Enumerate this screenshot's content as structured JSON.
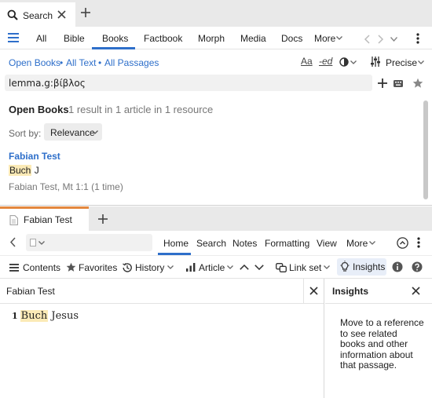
{
  "top_panel": {
    "tab": {
      "label": "Search"
    },
    "search_types": [
      "All",
      "Bible",
      "Books",
      "Factbook",
      "Morph",
      "Media",
      "Docs"
    ],
    "active_type": "Books",
    "more_label": "More",
    "scope": {
      "open_books": "Open Books",
      "all_text": "All Text",
      "all_passages": "All Passages",
      "separator": "•"
    },
    "options": {
      "aa": "Aa",
      "ed": "-ed",
      "match_mode": "Precise"
    },
    "query": "lemma.g:βίβλος",
    "results": {
      "title": "Open Books",
      "summary": "1 result in 1 article in 1 resource",
      "sort_label": "Sort by:",
      "sort_value": "Relevance",
      "item": {
        "title": "Fabian Test",
        "hit_word": "Buch",
        "rest": " J",
        "meta": "Fabian Test, Mt 1:1 (1 time)"
      }
    }
  },
  "bottom_panel": {
    "tab": {
      "label": "Fabian Test"
    },
    "nav_tabs": [
      "Home",
      "Search",
      "Notes",
      "Formatting",
      "View",
      "More"
    ],
    "active_nav": "Home",
    "toolbar": {
      "contents": "Contents",
      "favorites": "Favorites",
      "history": "History",
      "article": "Article",
      "link_set": "Link set",
      "insights": "Insights"
    },
    "document": {
      "title": "Fabian Test",
      "verse_number": "1",
      "hit_word": "Buch",
      "rest": " Jesus"
    },
    "insights": {
      "title": "Insights",
      "message": "Move to a reference to see related books and other information about that passage."
    }
  },
  "colors": {
    "accent_blue": "#2e6fca",
    "highlight": "#fbeab6",
    "active_tab_orange": "#e3873e"
  }
}
